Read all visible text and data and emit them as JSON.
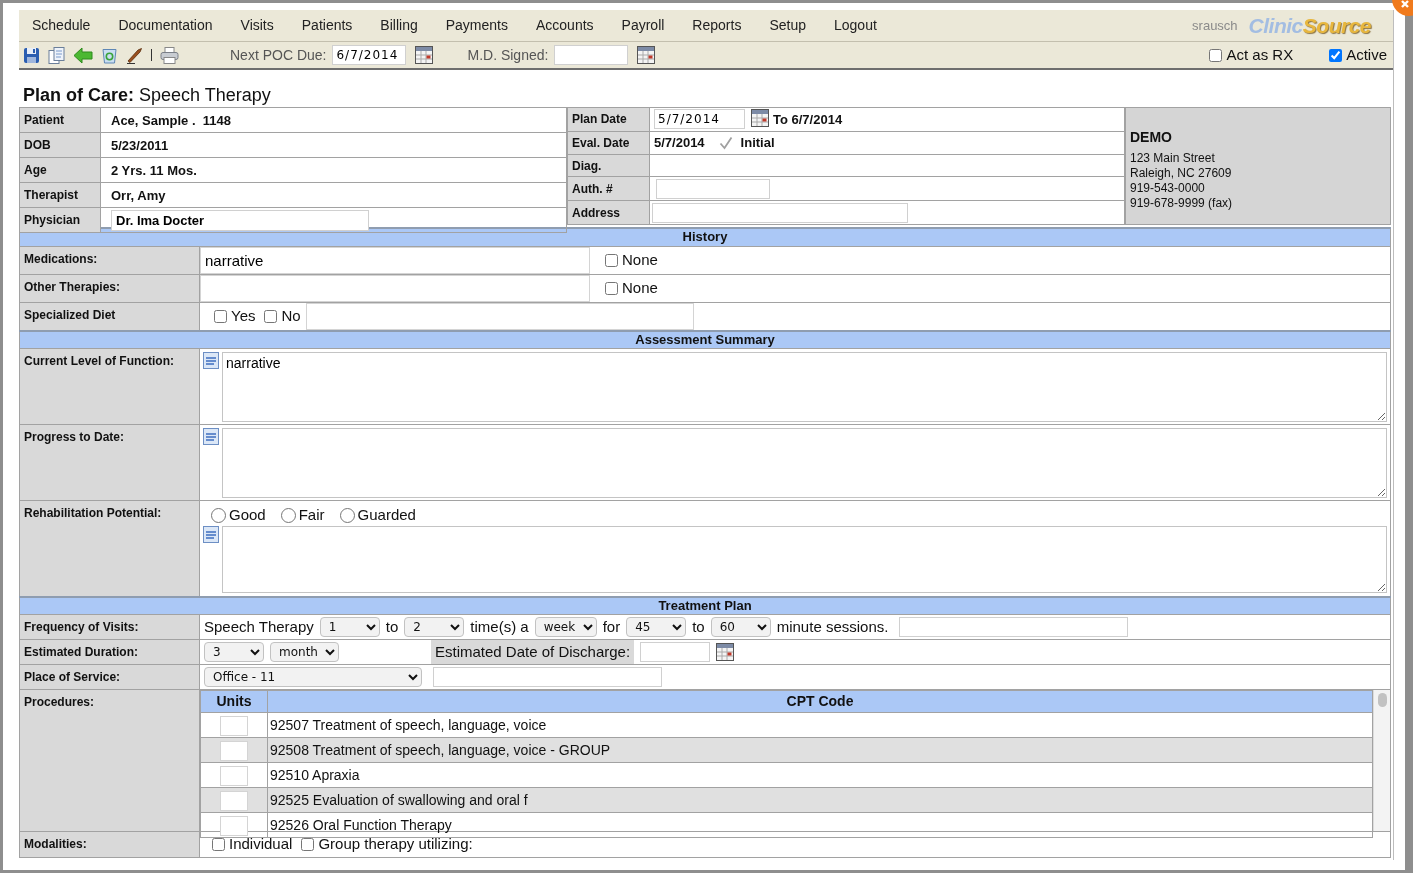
{
  "menu": {
    "items": [
      "Schedule",
      "Documentation",
      "Visits",
      "Patients",
      "Billing",
      "Payments",
      "Accounts",
      "Payroll",
      "Reports",
      "Setup",
      "Logout"
    ],
    "user": "srausch",
    "logo": [
      "Clinic",
      "Source"
    ]
  },
  "toolbar": {
    "fields": [
      {
        "label": "Next POC Due:",
        "value": "6/7/2014"
      },
      {
        "label": "M.D. Signed:"
      }
    ],
    "checks": [
      {
        "label": "Act as RX",
        "checked": false
      },
      {
        "label": "Active",
        "checked": true
      }
    ]
  },
  "title": "**Plan of Care:** Speech Therapy",
  "patient_info": [
    {
      "label": "Patient",
      "kind": "text",
      "value": "Ace, Sample .  1148"
    },
    {
      "label": "DOB",
      "kind": "text",
      "value": "5/23/2011"
    },
    {
      "label": "Age",
      "kind": "text",
      "value": "2 Yrs. 11 Mos."
    },
    {
      "label": "Therapist",
      "kind": "text",
      "value": "Orr, Amy"
    },
    {
      "label": "Physician",
      "kind": "input",
      "value": "Dr. Ima Docter"
    }
  ],
  "plan_info": [
    {
      "label": "Plan Date",
      "kind": "date",
      "value": "5/7/2014",
      "suffix": "To 6/7/2014"
    },
    {
      "label": "Eval. Date",
      "kind": "check",
      "value": "5/7/2014",
      "check": {
        "label": "Initial",
        "checked": true
      }
    },
    {
      "label": "Diag.",
      "kind": "blank"
    },
    {
      "label": "Auth. #",
      "kind": "input",
      "wide": false
    },
    {
      "label": "Address",
      "kind": "input",
      "wide": true
    }
  ],
  "clinic": {
    "name": "DEMO",
    "lines": [
      "123 Main Street",
      "Raleigh, NC 27609",
      "919-543-0000",
      "919-678-9999 (fax)"
    ]
  },
  "sections": [
    {
      "title": "History",
      "rows": [
        {
          "label": "Medications:",
          "kind": "text_none",
          "value": "narrative",
          "none": {
            "label": "None",
            "checked": false
          }
        },
        {
          "label": "Other Therapies:",
          "kind": "text_none",
          "none": {
            "label": "None",
            "checked": false
          }
        },
        {
          "label": "Specialized Diet",
          "kind": "yes_no",
          "options": [
            {
              "label": "Yes",
              "checked": false
            },
            {
              "label": "No",
              "checked": false
            }
          ]
        }
      ]
    },
    {
      "title": "Assessment Summary",
      "rows": [
        {
          "label": "Current Level of Function:",
          "kind": "narrative",
          "value": "narrative"
        },
        {
          "label": "Progress to Date:",
          "kind": "narrative"
        },
        {
          "label": "Rehabilitation Potential:",
          "kind": "radio_narrative",
          "options": [
            {
              "label": "Good",
              "selected": false
            },
            {
              "label": "Fair",
              "selected": false
            },
            {
              "label": "Guarded",
              "selected": false
            }
          ]
        }
      ]
    },
    {
      "title": "Treatment Plan",
      "rows": [
        {
          "label": "Frequency of Visits:",
          "kind": "inline",
          "items": [
            {
              "kind": "text",
              "text": "Speech Therapy"
            },
            {
              "kind": "select",
              "value": "1"
            },
            {
              "kind": "text",
              "text": "to"
            },
            {
              "kind": "select",
              "value": "2"
            },
            {
              "kind": "text",
              "text": "time(s) a"
            },
            {
              "kind": "select",
              "value": "week"
            },
            {
              "kind": "text",
              "text": "for"
            },
            {
              "kind": "select",
              "value": "45"
            },
            {
              "kind": "text",
              "text": "to"
            },
            {
              "kind": "select",
              "value": "60"
            },
            {
              "kind": "text",
              "text": "minute sessions."
            },
            {
              "kind": "input",
              "wide": true
            }
          ]
        },
        {
          "label": "Estimated Duration:",
          "kind": "inline",
          "items": [
            {
              "kind": "select",
              "value": "3"
            },
            {
              "kind": "select",
              "value": "month"
            },
            {
              "kind": "label",
              "text": "Estimated Date of Discharge:"
            },
            {
              "kind": "input",
              "wide": false
            },
            {
              "kind": "calendar"
            }
          ]
        },
        {
          "label": "Place of Service:",
          "kind": "inline",
          "items": [
            {
              "kind": "select",
              "value": "Office - 11",
              "wide": true
            },
            {
              "kind": "input",
              "wide": true
            }
          ]
        },
        {
          "label": "Procedures:",
          "kind": "procedures",
          "columns": [
            "Units",
            "CPT Code"
          ],
          "rows": [
            "92507 Treatment of speech, language, voice",
            "92508 Treatment of speech, language, voice - GROUP",
            "92510 Apraxia",
            "92525 Evaluation of swallowing and oral f",
            "92526 Oral Function Therapy"
          ]
        },
        {
          "label": "Modalities:",
          "kind": "checks",
          "options": [
            {
              "label": "Individual",
              "checked": false
            },
            {
              "label": "Group therapy utilizing:",
              "checked": false
            }
          ]
        }
      ]
    }
  ]
}
